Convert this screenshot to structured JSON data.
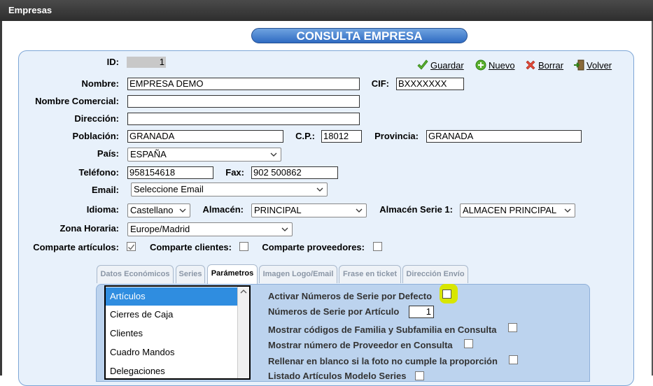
{
  "window": {
    "title": "Empresas"
  },
  "header": {
    "title": "CONSULTA EMPRESA"
  },
  "actions": {
    "save": "Guardar",
    "new": "Nuevo",
    "delete": "Borrar",
    "back": "Volver"
  },
  "fields": {
    "id": {
      "label": "ID:",
      "value": "1"
    },
    "nombre": {
      "label": "Nombre:",
      "value": "EMPRESA DEMO"
    },
    "cif": {
      "label": "CIF:",
      "value": "BXXXXXXX"
    },
    "nombre_comercial": {
      "label": "Nombre Comercial:",
      "value": ""
    },
    "direccion": {
      "label": "Dirección:",
      "value": ""
    },
    "poblacion": {
      "label": "Población:",
      "value": "GRANADA"
    },
    "cp": {
      "label": "C.P.:",
      "value": "18012"
    },
    "provincia": {
      "label": "Provincia:",
      "value": "GRANADA"
    },
    "pais": {
      "label": "País:",
      "value": "ESPAÑA"
    },
    "telefono": {
      "label": "Teléfono:",
      "value": "958154618"
    },
    "fax": {
      "label": "Fax:",
      "value": "902 500862"
    },
    "email": {
      "label": "Email:",
      "value": "Seleccione Email"
    },
    "idioma": {
      "label": "Idioma:",
      "value": "Castellano"
    },
    "almacen": {
      "label": "Almacén:",
      "value": "PRINCIPAL"
    },
    "almacen_serie1": {
      "label": "Almacén Serie 1:",
      "value": "ALMACEN PRINCIPAL"
    },
    "zona_horaria": {
      "label": "Zona Horaria:",
      "value": "Europe/Madrid"
    }
  },
  "shares": {
    "articulos": {
      "label": "Comparte artículos:",
      "checked": true
    },
    "clientes": {
      "label": "Comparte clientes:",
      "checked": false
    },
    "proveedores": {
      "label": "Comparte proveedores:",
      "checked": false
    }
  },
  "tabs": [
    {
      "label": "Datos Económicos",
      "active": false
    },
    {
      "label": "Series",
      "active": false
    },
    {
      "label": "Parámetros",
      "active": true
    },
    {
      "label": "Imagen Logo/Email",
      "active": false
    },
    {
      "label": "Frase en ticket",
      "active": false
    },
    {
      "label": "Dirección Envío",
      "active": false
    }
  ],
  "param_sections": [
    "Artículos",
    "Cierres de Caja",
    "Clientes",
    "Cuadro Mandos",
    "Delegaciones"
  ],
  "params": {
    "activar_numeros_serie": {
      "label": "Activar Números de Serie por Defecto",
      "checked": false
    },
    "numeros_serie_articulo": {
      "label": "Números de Serie por Artículo",
      "value": "1"
    },
    "mostrar_codigos_familia": {
      "label": "Mostrar códigos de Familia y Subfamilia en Consulta",
      "checked": false
    },
    "mostrar_numero_proveedor": {
      "label": "Mostrar número de Proveedor en Consulta",
      "checked": false
    },
    "rellenar_blanco_foto": {
      "label": "Rellenar en blanco si la foto no cumple la proporción",
      "checked": false
    },
    "listado_articulos": {
      "label": "Listado Artículos Modelo Series",
      "checked": false
    }
  },
  "colors": {
    "header": "#2f6bc2",
    "panel": "#e8f1fb",
    "selected": "#2f8de0",
    "highlight": "#d8e600"
  }
}
